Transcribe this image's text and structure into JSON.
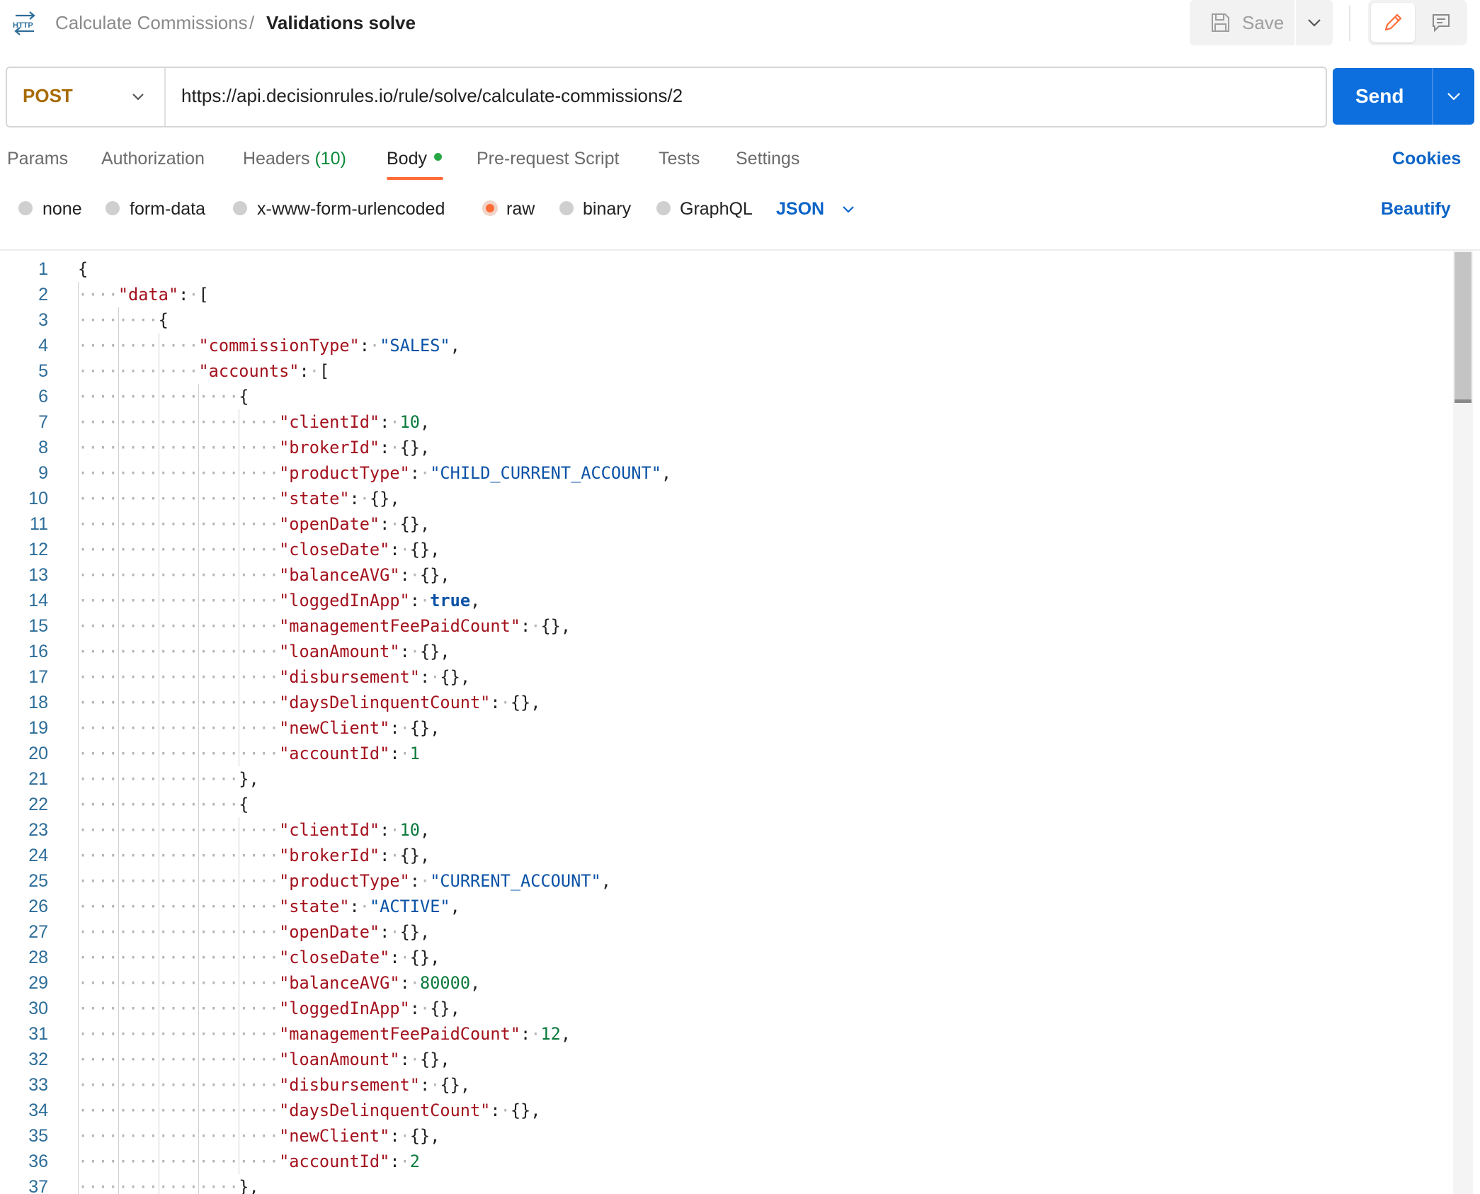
{
  "header": {
    "icon": "http-icon",
    "breadcrumb_parent": "Calculate Commissions",
    "breadcrumb_sep": "/",
    "breadcrumb_current": "Validations solve",
    "save_label": "Save"
  },
  "request": {
    "method": "POST",
    "url": "https://api.decisionrules.io/rule/solve/calculate-commissions/2",
    "send_label": "Send"
  },
  "tabs": {
    "params": "Params",
    "authorization": "Authorization",
    "headers": "Headers",
    "headers_count": "(10)",
    "body": "Body",
    "pre_request": "Pre-request Script",
    "tests": "Tests",
    "settings": "Settings",
    "cookies": "Cookies",
    "active": "Body"
  },
  "body_options": {
    "none": "none",
    "form_data": "form-data",
    "urlencoded": "x-www-form-urlencoded",
    "raw": "raw",
    "binary": "binary",
    "graphql": "GraphQL",
    "selected": "raw",
    "format": "JSON",
    "beautify": "Beautify"
  },
  "colors": {
    "accent_orange": "#ff6c37",
    "send_blue": "#0d6fdd",
    "link_blue": "#0b63c7",
    "method_post": "#a86b00",
    "json_key": "#a3111c",
    "json_string": "#0a52a6",
    "json_number": "#0b7a3b"
  },
  "editor": {
    "lines": [
      {
        "n": "1",
        "indent": 0,
        "parts": [
          {
            "t": "p",
            "v": "{"
          }
        ]
      },
      {
        "n": "2",
        "indent": 1,
        "parts": [
          {
            "t": "k",
            "v": "\"data\""
          },
          {
            "t": "p",
            "v": ": "
          },
          {
            "t": "p",
            "v": "["
          }
        ]
      },
      {
        "n": "3",
        "indent": 2,
        "parts": [
          {
            "t": "p",
            "v": "{"
          }
        ]
      },
      {
        "n": "4",
        "indent": 3,
        "parts": [
          {
            "t": "k",
            "v": "\"commissionType\""
          },
          {
            "t": "p",
            "v": ": "
          },
          {
            "t": "s",
            "v": "\"SALES\""
          },
          {
            "t": "p",
            "v": ","
          }
        ]
      },
      {
        "n": "5",
        "indent": 3,
        "parts": [
          {
            "t": "k",
            "v": "\"accounts\""
          },
          {
            "t": "p",
            "v": ": "
          },
          {
            "t": "p",
            "v": "["
          }
        ]
      },
      {
        "n": "6",
        "indent": 4,
        "parts": [
          {
            "t": "p",
            "v": "{"
          }
        ]
      },
      {
        "n": "7",
        "indent": 5,
        "parts": [
          {
            "t": "k",
            "v": "\"clientId\""
          },
          {
            "t": "p",
            "v": ": "
          },
          {
            "t": "n",
            "v": "10"
          },
          {
            "t": "p",
            "v": ","
          }
        ]
      },
      {
        "n": "8",
        "indent": 5,
        "parts": [
          {
            "t": "k",
            "v": "\"brokerId\""
          },
          {
            "t": "p",
            "v": ": "
          },
          {
            "t": "p",
            "v": "{},"
          }
        ]
      },
      {
        "n": "9",
        "indent": 5,
        "parts": [
          {
            "t": "k",
            "v": "\"productType\""
          },
          {
            "t": "p",
            "v": ": "
          },
          {
            "t": "s",
            "v": "\"CHILD_CURRENT_ACCOUNT\""
          },
          {
            "t": "p",
            "v": ","
          }
        ]
      },
      {
        "n": "10",
        "indent": 5,
        "parts": [
          {
            "t": "k",
            "v": "\"state\""
          },
          {
            "t": "p",
            "v": ": "
          },
          {
            "t": "p",
            "v": "{},"
          }
        ]
      },
      {
        "n": "11",
        "indent": 5,
        "parts": [
          {
            "t": "k",
            "v": "\"openDate\""
          },
          {
            "t": "p",
            "v": ": "
          },
          {
            "t": "p",
            "v": "{},"
          }
        ]
      },
      {
        "n": "12",
        "indent": 5,
        "parts": [
          {
            "t": "k",
            "v": "\"closeDate\""
          },
          {
            "t": "p",
            "v": ": "
          },
          {
            "t": "p",
            "v": "{},"
          }
        ]
      },
      {
        "n": "13",
        "indent": 5,
        "parts": [
          {
            "t": "k",
            "v": "\"balanceAVG\""
          },
          {
            "t": "p",
            "v": ": "
          },
          {
            "t": "p",
            "v": "{},"
          }
        ]
      },
      {
        "n": "14",
        "indent": 5,
        "parts": [
          {
            "t": "k",
            "v": "\"loggedInApp\""
          },
          {
            "t": "p",
            "v": ": "
          },
          {
            "t": "b",
            "v": "true"
          },
          {
            "t": "p",
            "v": ","
          }
        ]
      },
      {
        "n": "15",
        "indent": 5,
        "parts": [
          {
            "t": "k",
            "v": "\"managementFeePaidCount\""
          },
          {
            "t": "p",
            "v": ": "
          },
          {
            "t": "p",
            "v": "{},"
          }
        ]
      },
      {
        "n": "16",
        "indent": 5,
        "parts": [
          {
            "t": "k",
            "v": "\"loanAmount\""
          },
          {
            "t": "p",
            "v": ": "
          },
          {
            "t": "p",
            "v": "{},"
          }
        ]
      },
      {
        "n": "17",
        "indent": 5,
        "parts": [
          {
            "t": "k",
            "v": "\"disbursement\""
          },
          {
            "t": "p",
            "v": ": "
          },
          {
            "t": "p",
            "v": "{},"
          }
        ]
      },
      {
        "n": "18",
        "indent": 5,
        "parts": [
          {
            "t": "k",
            "v": "\"daysDelinquentCount\""
          },
          {
            "t": "p",
            "v": ": "
          },
          {
            "t": "p",
            "v": "{},"
          }
        ]
      },
      {
        "n": "19",
        "indent": 5,
        "parts": [
          {
            "t": "k",
            "v": "\"newClient\""
          },
          {
            "t": "p",
            "v": ": "
          },
          {
            "t": "p",
            "v": "{},"
          }
        ]
      },
      {
        "n": "20",
        "indent": 5,
        "parts": [
          {
            "t": "k",
            "v": "\"accountId\""
          },
          {
            "t": "p",
            "v": ": "
          },
          {
            "t": "n",
            "v": "1"
          }
        ]
      },
      {
        "n": "21",
        "indent": 4,
        "parts": [
          {
            "t": "p",
            "v": "},"
          }
        ]
      },
      {
        "n": "22",
        "indent": 4,
        "parts": [
          {
            "t": "p",
            "v": "{"
          }
        ]
      },
      {
        "n": "23",
        "indent": 5,
        "parts": [
          {
            "t": "k",
            "v": "\"clientId\""
          },
          {
            "t": "p",
            "v": ": "
          },
          {
            "t": "n",
            "v": "10"
          },
          {
            "t": "p",
            "v": ","
          }
        ]
      },
      {
        "n": "24",
        "indent": 5,
        "parts": [
          {
            "t": "k",
            "v": "\"brokerId\""
          },
          {
            "t": "p",
            "v": ": "
          },
          {
            "t": "p",
            "v": "{},"
          }
        ]
      },
      {
        "n": "25",
        "indent": 5,
        "parts": [
          {
            "t": "k",
            "v": "\"productType\""
          },
          {
            "t": "p",
            "v": ": "
          },
          {
            "t": "s",
            "v": "\"CURRENT_ACCOUNT\""
          },
          {
            "t": "p",
            "v": ","
          }
        ]
      },
      {
        "n": "26",
        "indent": 5,
        "parts": [
          {
            "t": "k",
            "v": "\"state\""
          },
          {
            "t": "p",
            "v": ": "
          },
          {
            "t": "s",
            "v": "\"ACTIVE\""
          },
          {
            "t": "p",
            "v": ","
          }
        ]
      },
      {
        "n": "27",
        "indent": 5,
        "parts": [
          {
            "t": "k",
            "v": "\"openDate\""
          },
          {
            "t": "p",
            "v": ": "
          },
          {
            "t": "p",
            "v": "{},"
          }
        ]
      },
      {
        "n": "28",
        "indent": 5,
        "parts": [
          {
            "t": "k",
            "v": "\"closeDate\""
          },
          {
            "t": "p",
            "v": ": "
          },
          {
            "t": "p",
            "v": "{},"
          }
        ]
      },
      {
        "n": "29",
        "indent": 5,
        "parts": [
          {
            "t": "k",
            "v": "\"balanceAVG\""
          },
          {
            "t": "p",
            "v": ": "
          },
          {
            "t": "n",
            "v": "80000"
          },
          {
            "t": "p",
            "v": ","
          }
        ]
      },
      {
        "n": "30",
        "indent": 5,
        "parts": [
          {
            "t": "k",
            "v": "\"loggedInApp\""
          },
          {
            "t": "p",
            "v": ": "
          },
          {
            "t": "p",
            "v": "{},"
          }
        ]
      },
      {
        "n": "31",
        "indent": 5,
        "parts": [
          {
            "t": "k",
            "v": "\"managementFeePaidCount\""
          },
          {
            "t": "p",
            "v": ": "
          },
          {
            "t": "n",
            "v": "12"
          },
          {
            "t": "p",
            "v": ","
          }
        ]
      },
      {
        "n": "32",
        "indent": 5,
        "parts": [
          {
            "t": "k",
            "v": "\"loanAmount\""
          },
          {
            "t": "p",
            "v": ": "
          },
          {
            "t": "p",
            "v": "{},"
          }
        ]
      },
      {
        "n": "33",
        "indent": 5,
        "parts": [
          {
            "t": "k",
            "v": "\"disbursement\""
          },
          {
            "t": "p",
            "v": ": "
          },
          {
            "t": "p",
            "v": "{},"
          }
        ]
      },
      {
        "n": "34",
        "indent": 5,
        "parts": [
          {
            "t": "k",
            "v": "\"daysDelinquentCount\""
          },
          {
            "t": "p",
            "v": ": "
          },
          {
            "t": "p",
            "v": "{},"
          }
        ]
      },
      {
        "n": "35",
        "indent": 5,
        "parts": [
          {
            "t": "k",
            "v": "\"newClient\""
          },
          {
            "t": "p",
            "v": ": "
          },
          {
            "t": "p",
            "v": "{},"
          }
        ]
      },
      {
        "n": "36",
        "indent": 5,
        "parts": [
          {
            "t": "k",
            "v": "\"accountId\""
          },
          {
            "t": "p",
            "v": ": "
          },
          {
            "t": "n",
            "v": "2"
          }
        ]
      },
      {
        "n": "37",
        "indent": 4,
        "parts": [
          {
            "t": "p",
            "v": "},"
          }
        ]
      }
    ]
  }
}
